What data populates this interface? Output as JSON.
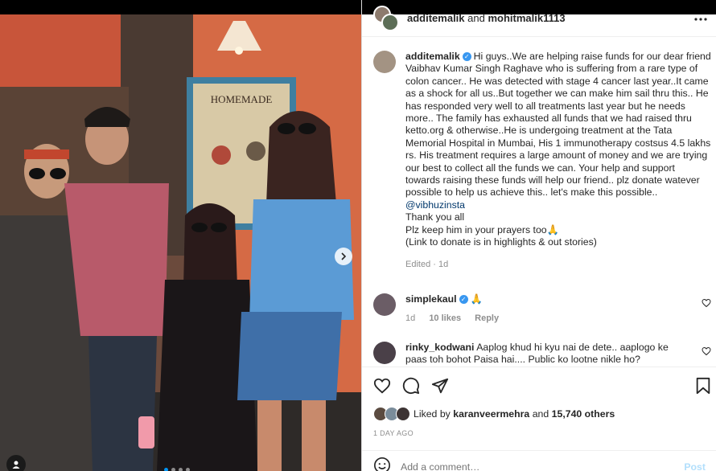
{
  "header": {
    "user1": "additemalik",
    "joiner": "and",
    "user2": "mohitmalik1113"
  },
  "caption": {
    "username": "additemalik",
    "text": "Hi guys..We are helping raise funds for our dear friend Vaibhav Kumar Singh Raghave who is suffering from a rare type of colon cancer.. He was detected with stage 4 cancer last year..It came as a shock for all us..But together we can make him sail thru this.. He has responded very well to all treatments last year but he needs more.. The family has exhausted all funds that we had raised thru ketto.org & otherwise..He is undergoing treatment at the Tata Memorial Hospital in Mumbai, His 1 immunotherapy costsus 4.5 lakhs rs. His treatment requires a large amount of money and we are trying our best to collect all the funds we can. Your help and support towards raising these funds will help our friend.. plz donate watever possible to help us achieve this.. let's make this possible.. ",
    "mention": "@vibhuzinsta",
    "line2": "Thank you all",
    "line3": "Plz keep him in your prayers too🙏",
    "line4": "(Link to donate is in highlights & out stories)",
    "edited": "Edited · 1d"
  },
  "comments": [
    {
      "username": "simplekaul",
      "text": "🙏",
      "time": "1d",
      "likes": "10 likes",
      "reply": "Reply"
    },
    {
      "username": "rinky_kodwani",
      "text": "Aaplog khud hi kyu nai de dete.. aaplogo ke paas toh bohot Paisa hai.... Public ko lootne nikle ho?"
    }
  ],
  "likes": {
    "prefix": "Liked by",
    "user": "karanveermehra",
    "middle": "and",
    "others": "15,740 others"
  },
  "date": "1 DAY AGO",
  "add_comment": {
    "placeholder": "Add a comment…",
    "post_label": "Post"
  },
  "icons": {
    "like": "heart-icon",
    "comment": "comment-icon",
    "share": "share-icon",
    "save": "bookmark-icon",
    "emoji": "emoji-icon"
  },
  "colors": {
    "accent": "#0095f6",
    "mention": "#00376b",
    "verified": "#3897f0",
    "muted": "#8e8e8e"
  }
}
